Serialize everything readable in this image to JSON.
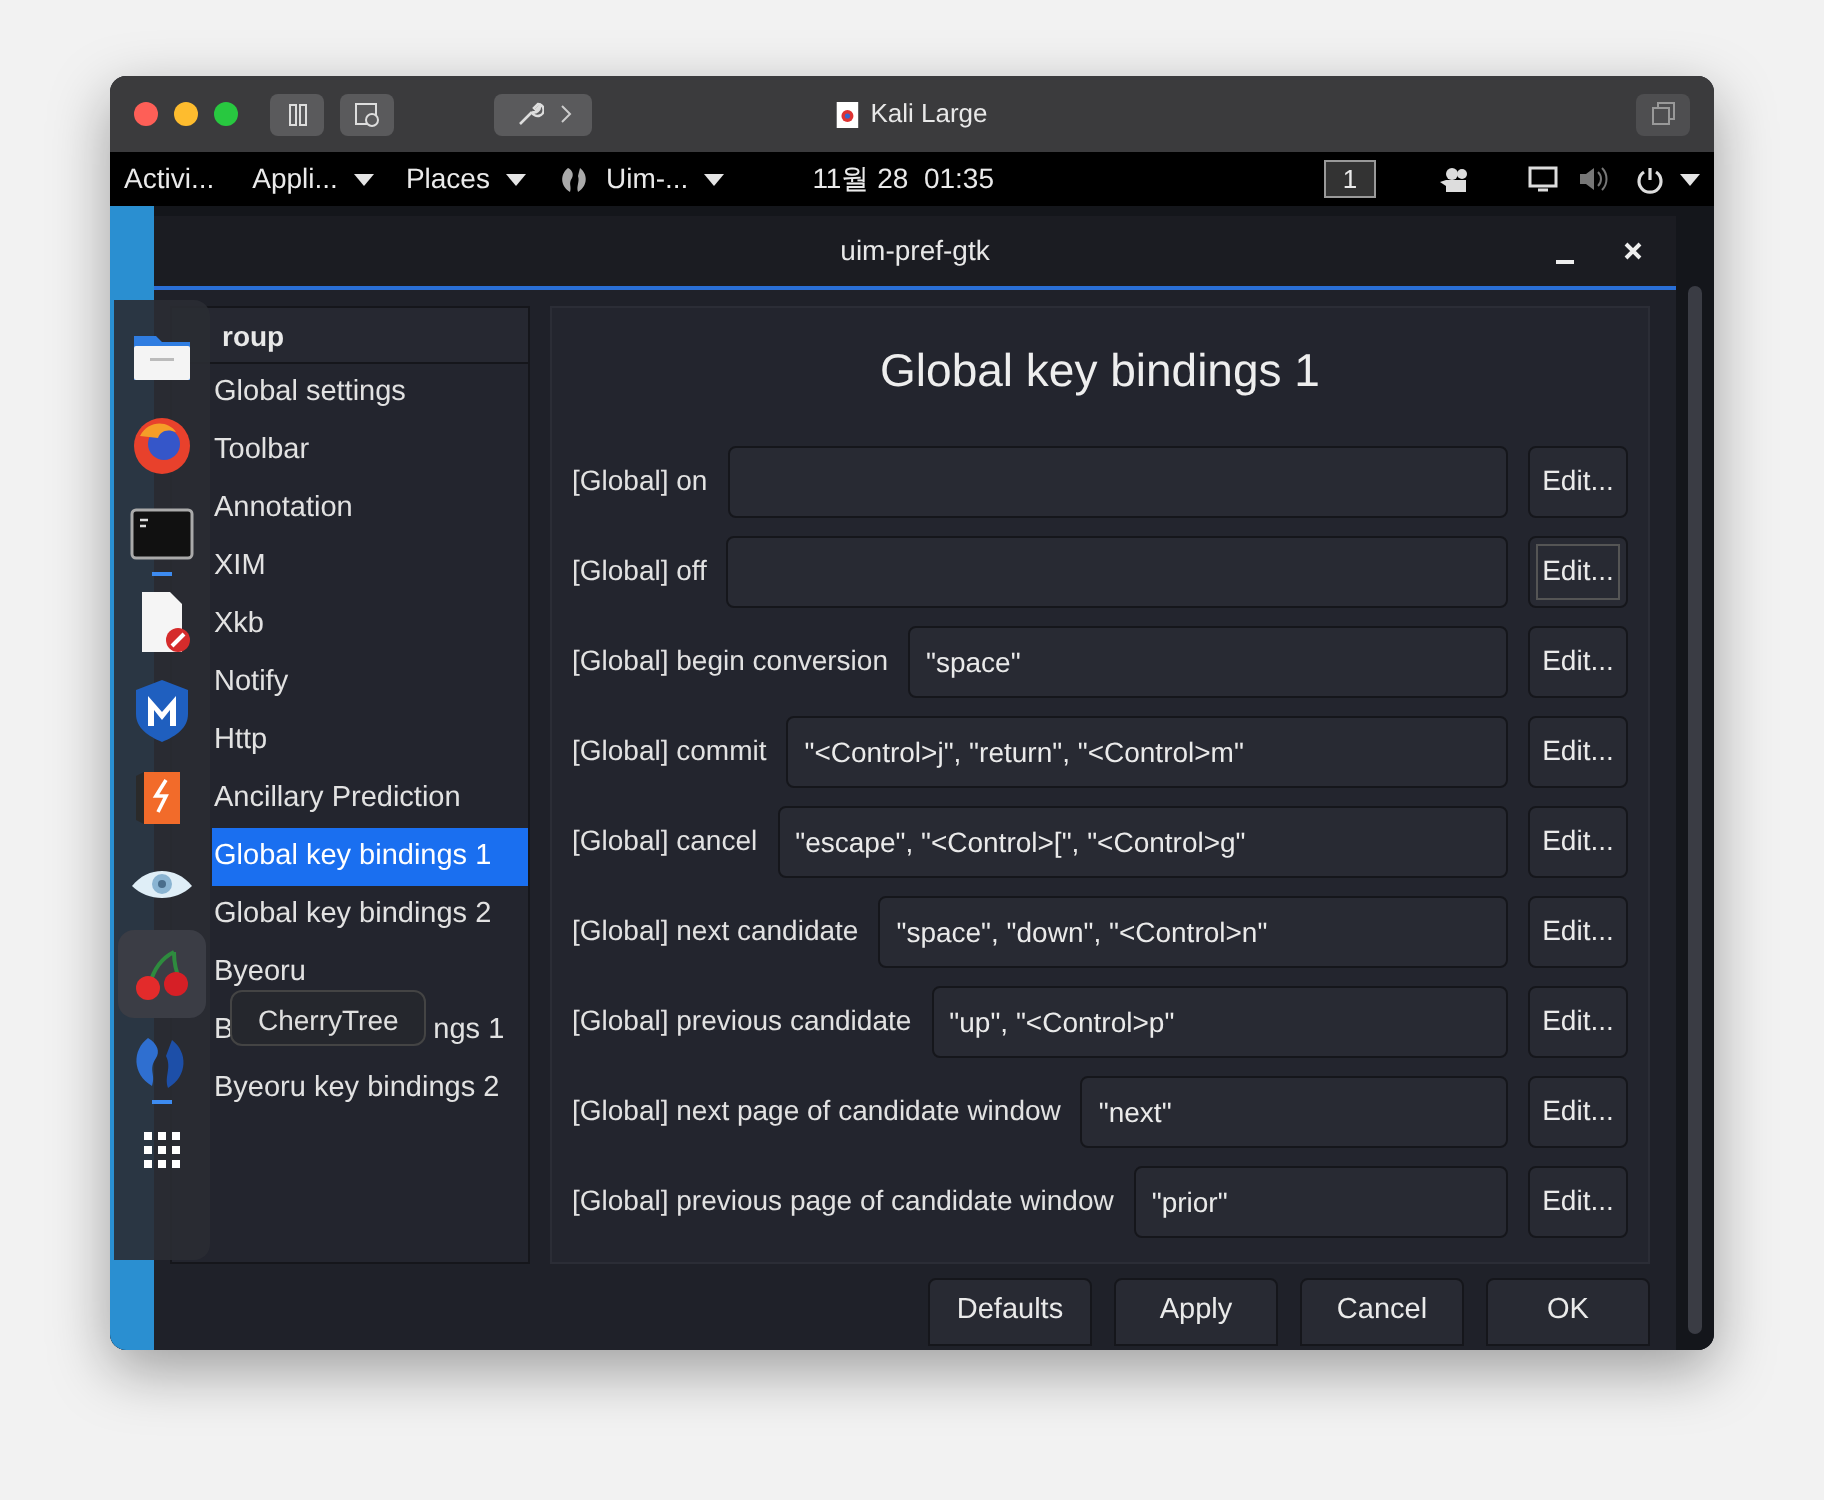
{
  "host_window": {
    "title": "Kali Large"
  },
  "top_bar": {
    "activities": "Activi...",
    "menus": [
      {
        "kind": "plain",
        "label": "Appli..."
      },
      {
        "kind": "plain",
        "label": "Places"
      },
      {
        "kind": "app",
        "label": "Uim-..."
      }
    ],
    "clock": "11월 28  01:35",
    "workspace": "1"
  },
  "dock": {
    "items": [
      {
        "kind": "folder",
        "running": false,
        "hovered": false
      },
      {
        "kind": "browser",
        "running": false,
        "hovered": false
      },
      {
        "kind": "terminal",
        "running": true,
        "hovered": false
      },
      {
        "kind": "editor",
        "running": false,
        "hovered": false
      },
      {
        "kind": "shield",
        "running": false,
        "hovered": false
      },
      {
        "kind": "burst",
        "running": false,
        "hovered": false
      },
      {
        "kind": "eye",
        "running": false,
        "hovered": false
      },
      {
        "kind": "cherry",
        "running": false,
        "hovered": true
      },
      {
        "kind": "dragon",
        "running": true,
        "hovered": false
      },
      {
        "kind": "grid",
        "running": false,
        "hovered": false
      }
    ],
    "tooltip": "CherryTree"
  },
  "dialog": {
    "title": "uim-pref-gtk",
    "sidebar": {
      "header": "roup",
      "items": [
        {
          "label": "Global settings",
          "selected": false
        },
        {
          "label": "Toolbar",
          "selected": false
        },
        {
          "label": "Annotation",
          "selected": false
        },
        {
          "label": "XIM",
          "selected": false
        },
        {
          "label": "Xkb",
          "selected": false
        },
        {
          "label": "Notify",
          "selected": false
        },
        {
          "label": "Http",
          "selected": false
        },
        {
          "label": "Ancillary Prediction",
          "selected": false
        },
        {
          "label": "Global key bindings 1",
          "selected": true
        },
        {
          "label": "Global key bindings 2",
          "selected": false
        },
        {
          "label": "Byeoru",
          "selected": false
        },
        {
          "label": "B",
          "label_tail": "ngs 1",
          "selected": false
        },
        {
          "label": "Byeoru key bindings 2",
          "selected": false
        }
      ]
    },
    "panel": {
      "title": "Global key bindings 1",
      "rows": [
        {
          "label": "[Global] on",
          "button": "Edit...",
          "focused": false
        },
        {
          "label": "[Global] off",
          "button": "Edit...",
          "focused": true
        },
        {
          "label": "[Global] begin conversion",
          "value": "\"space\"",
          "button": "Edit...",
          "focused": false
        },
        {
          "label": "[Global] commit",
          "value": "\"<Control>j\", \"return\", \"<Control>m\"",
          "button": "Edit...",
          "focused": false
        },
        {
          "label": "[Global] cancel",
          "value": "\"escape\", \"<Control>[\", \"<Control>g\"",
          "button": "Edit...",
          "focused": false
        },
        {
          "label": "[Global] next candidate",
          "value": "\"space\", \"down\", \"<Control>n\"",
          "button": "Edit...",
          "focused": false
        },
        {
          "label": "[Global] previous candidate",
          "value": "\"up\", \"<Control>p\"",
          "button": "Edit...",
          "focused": false
        },
        {
          "label": "[Global] next page of candidate window",
          "value": "\"next\"",
          "button": "Edit...",
          "focused": false
        },
        {
          "label": "[Global] previous page of candidate window",
          "value": "\"prior\"",
          "button": "Edit...",
          "focused": false
        }
      ]
    },
    "buttons": [
      "Defaults",
      "Apply",
      "Cancel",
      "OK"
    ]
  }
}
